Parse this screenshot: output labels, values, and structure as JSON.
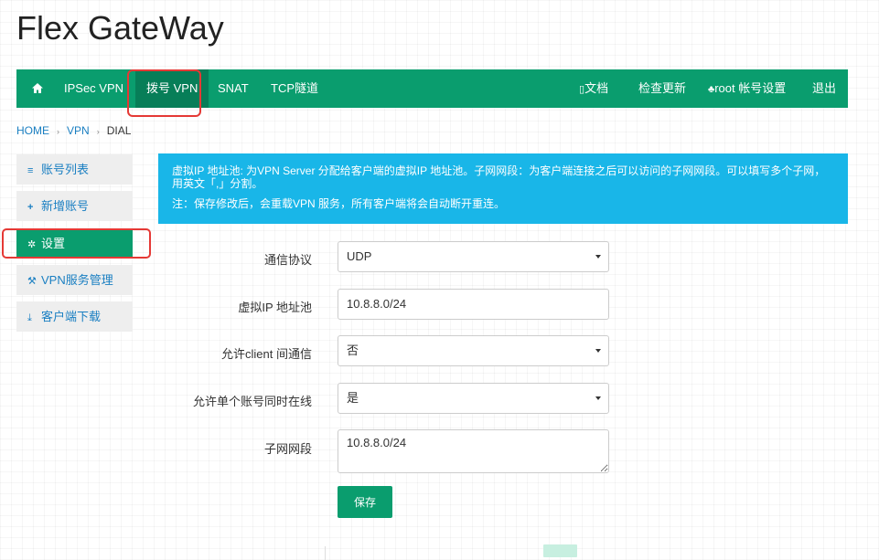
{
  "app": {
    "title": "Flex GateWay"
  },
  "nav": {
    "left": [
      "IPSec VPN",
      "拨号 VPN",
      "SNAT",
      "TCP隧道"
    ],
    "right": [
      "文档",
      "检查更新",
      "root 帐号设置",
      "退出"
    ]
  },
  "breadcrumb": {
    "home": "HOME",
    "vpn": "VPN",
    "current": "DIAL"
  },
  "sidebar": {
    "items": [
      {
        "icon": "list-icon",
        "label": "账号列表"
      },
      {
        "icon": "plus-icon",
        "label": "新增账号"
      },
      {
        "icon": "gear-icon",
        "label": "设置"
      },
      {
        "icon": "wrench-icon",
        "label": "VPN服务管理"
      },
      {
        "icon": "download-icon",
        "label": "客户端下载"
      }
    ]
  },
  "info": {
    "line1": "虚拟IP 地址池: 为VPN Server 分配给客户端的虚拟IP 地址池。子网网段：为客户端连接之后可以访问的子网网段。可以填写多个子网，用英文「,」分割。",
    "line2": "注：保存修改后，会重载VPN 服务，所有客户端将会自动断开重连。"
  },
  "form": {
    "protocol": {
      "label": "通信协议",
      "value": "UDP"
    },
    "ip_pool": {
      "label": "虚拟IP 地址池",
      "value": "10.8.8.0/24"
    },
    "client_to_client": {
      "label": "允许client 间通信",
      "value": "否"
    },
    "multi_login": {
      "label": "允许单个账号同时在线",
      "value": "是"
    },
    "subnet": {
      "label": "子网网段",
      "value": "10.8.8.0/24"
    },
    "save_label": "保存"
  },
  "colors": {
    "primary": "#0a9d6e",
    "info": "#19b6e8",
    "highlight": "#e53935"
  }
}
